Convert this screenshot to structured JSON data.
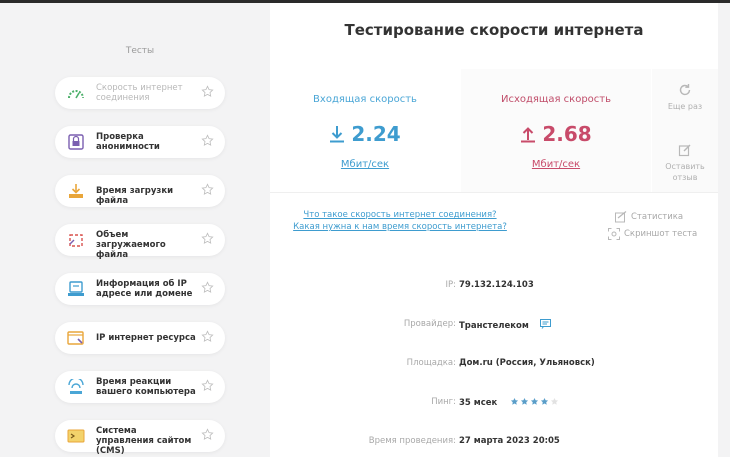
{
  "colors": {
    "accent_blue": "#3e9ccf",
    "accent_red": "#c84b6a",
    "star_filled": "#5a9ec9"
  },
  "sidebar": {
    "title": "Тесты",
    "items": [
      {
        "label": "Скорость интернет соединения",
        "icon": "speedometer-icon",
        "active": true
      },
      {
        "label": "Проверка анонимности",
        "icon": "anonymity-icon",
        "active": false
      },
      {
        "label": "Время загрузки файла",
        "icon": "file-download-icon",
        "active": false
      },
      {
        "label": "Объем загружаемого файла",
        "icon": "file-size-icon",
        "active": false
      },
      {
        "label": "Информация об IP адресе или домене",
        "icon": "ip-info-icon",
        "active": false
      },
      {
        "label": "IP интернет ресурса",
        "icon": "ip-resource-icon",
        "active": false
      },
      {
        "label": "Время реакции вашего компьютера",
        "icon": "reaction-time-icon",
        "active": false
      },
      {
        "label": "Система управления сайтом (CMS)",
        "icon": "cms-icon",
        "active": false
      }
    ]
  },
  "main": {
    "title": "Тестирование скорости интернета",
    "download": {
      "label": "Входящая скорость",
      "value": "2.24",
      "unit": "Мбит/сек"
    },
    "upload": {
      "label": "Исходящая скорость",
      "value": "2.68",
      "unit": "Мбит/сек"
    },
    "actions": {
      "again": "Еще раз",
      "feedback": "Оставить отзыв"
    },
    "faq": {
      "link1": "Что такое скорость интернет соединения?",
      "link2": "Какая нужна к нам время скорость интернета?"
    },
    "tools": {
      "stats": "Статистика",
      "screenshot": "Скриншот теста"
    },
    "info": {
      "ip_label": "IP:",
      "ip_value": "79.132.124.103",
      "provider_label": "Провайдер:",
      "provider_value": "Транстелеком",
      "site_label": "Площадка:",
      "site_value": "Дом.ru (Россия, Ульяновск)",
      "ping_label": "Пинг:",
      "ping_value": "35 мсек",
      "ping_rating": 4,
      "ping_rating_max": 5,
      "time_label": "Время проведения:",
      "time_value": "27 марта 2023 20:05"
    }
  }
}
